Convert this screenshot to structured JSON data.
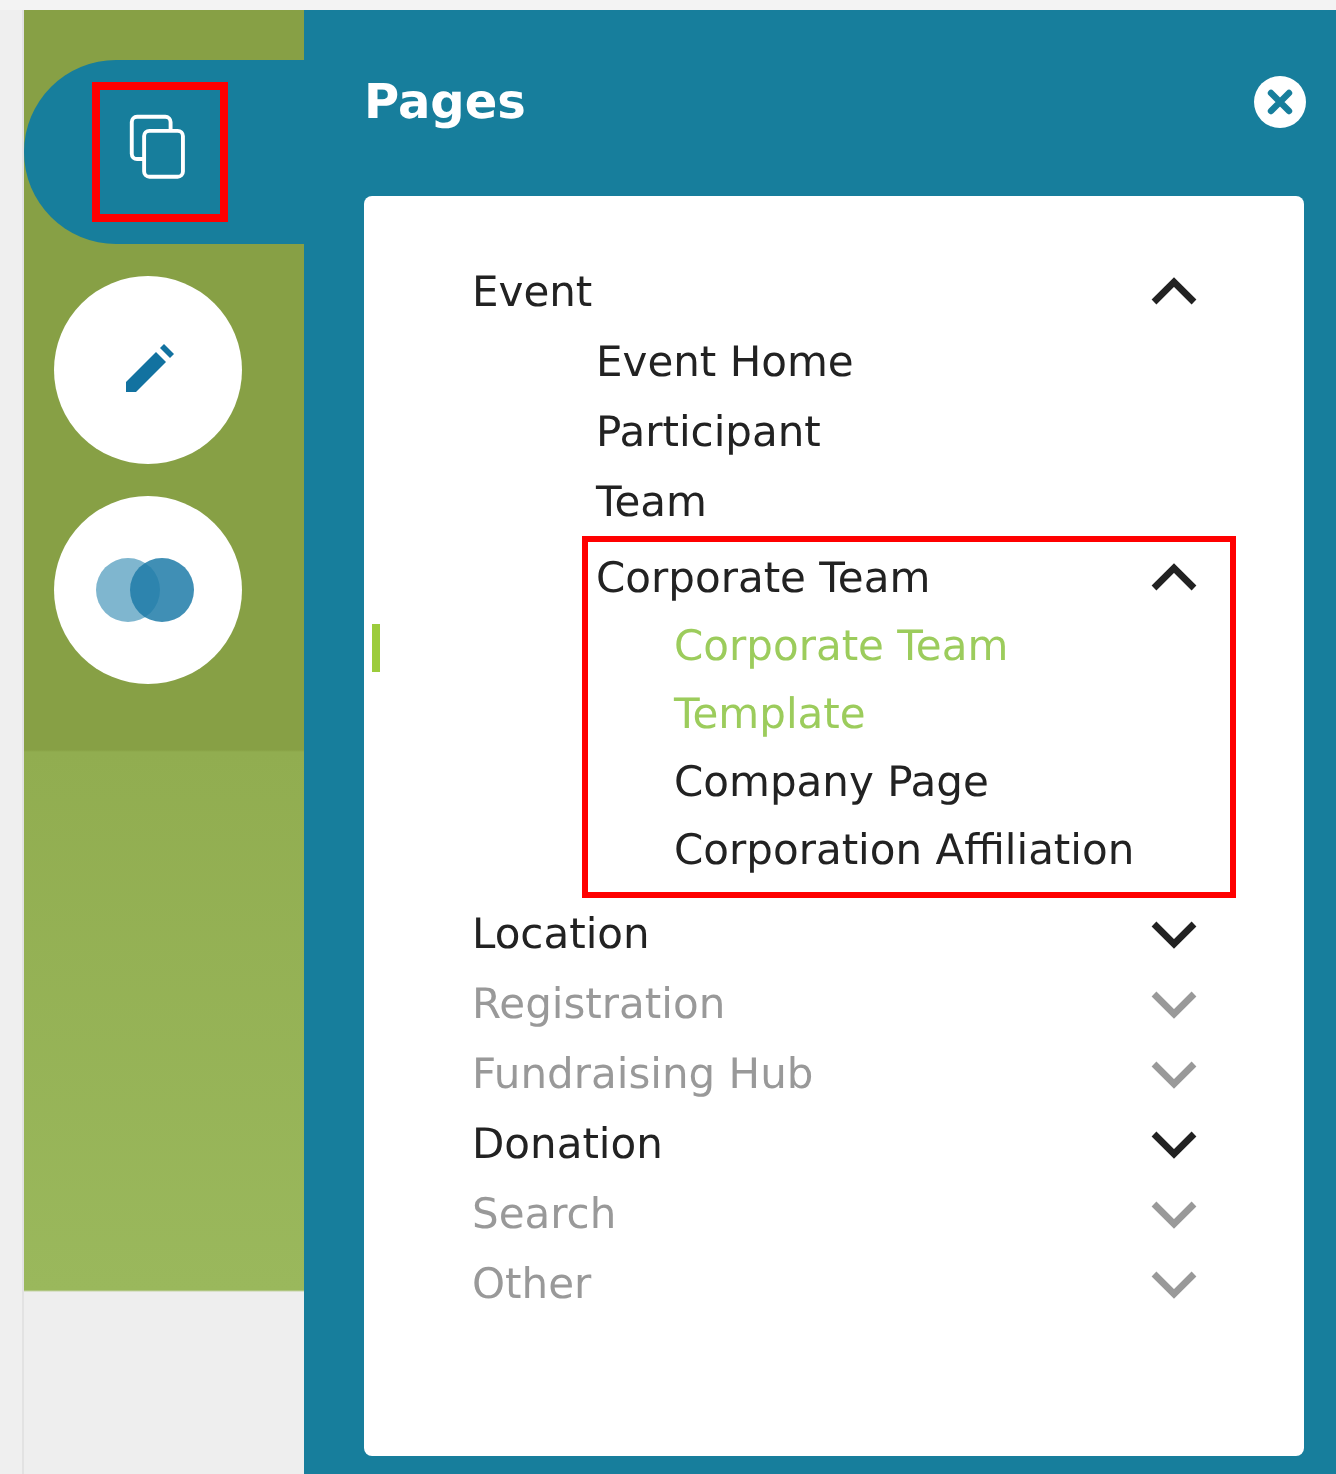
{
  "sidebar": {
    "buttons": [
      {
        "kind": "pages",
        "selected": true,
        "highlighted": true
      },
      {
        "kind": "edit",
        "selected": false,
        "highlighted": false
      },
      {
        "kind": "circles",
        "selected": false,
        "highlighted": false
      }
    ]
  },
  "panel": {
    "title": "Pages",
    "items": [
      {
        "label": "Event",
        "expanded": true,
        "disabled": false,
        "children": [
          {
            "label": "Event Home",
            "selected": false
          },
          {
            "label": "Participant",
            "selected": false
          },
          {
            "label": "Team",
            "selected": false
          },
          {
            "label": "Corporate Team",
            "selected": false,
            "expanded": true,
            "highlighted": true,
            "children": [
              {
                "label": "Corporate Team Template",
                "selected": true
              },
              {
                "label": "Company Page",
                "selected": false
              },
              {
                "label": "Corporation Affiliation",
                "selected": false
              }
            ]
          }
        ]
      },
      {
        "label": "Location",
        "expanded": false,
        "disabled": false
      },
      {
        "label": "Registration",
        "expanded": false,
        "disabled": true
      },
      {
        "label": "Fundraising Hub",
        "expanded": false,
        "disabled": true
      },
      {
        "label": "Donation",
        "expanded": false,
        "disabled": false
      },
      {
        "label": "Search",
        "expanded": false,
        "disabled": true
      },
      {
        "label": "Other",
        "expanded": false,
        "disabled": true
      }
    ]
  }
}
